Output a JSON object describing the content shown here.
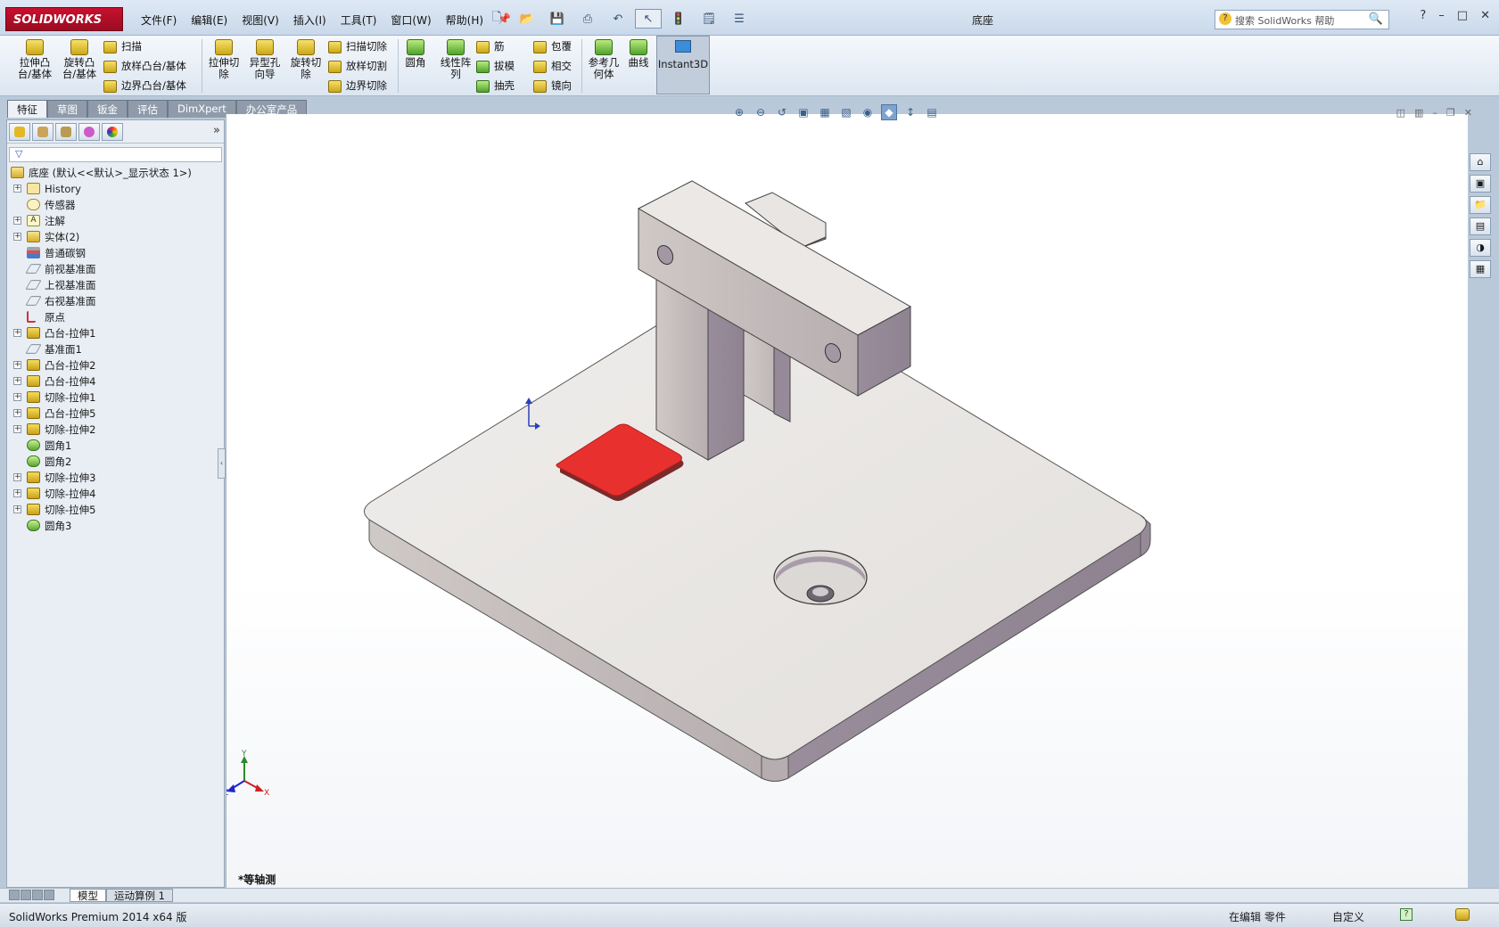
{
  "app": {
    "logo_text": "SOLIDWORKS",
    "document_title": "底座"
  },
  "menu": [
    "文件(F)",
    "编辑(E)",
    "视图(V)",
    "插入(I)",
    "工具(T)",
    "窗口(W)",
    "帮助(H)"
  ],
  "help_search": {
    "placeholder": "搜索 SolidWorks 帮助"
  },
  "ribbon": {
    "extrude_boss": "拉伸凸\n台/基体",
    "revolve_boss": "旋转凸\n台/基体",
    "sweep": "扫描",
    "loft_boss": "放样凸台/基体",
    "boundary_boss": "边界凸台/基体",
    "extrude_cut": "拉伸切\n除",
    "hole_wizard": "异型孔\n向导",
    "revolve_cut": "旋转切\n除",
    "sweep_cut": "扫描切除",
    "loft_cut": "放样切割",
    "boundary_cut": "边界切除",
    "fillet": "圆角",
    "linear_pattern": "线性阵\n列",
    "rib": "筋",
    "draft": "拔模",
    "shell": "抽壳",
    "wrap": "包覆",
    "intersect": "相交",
    "mirror": "镜向",
    "ref_geometry": "参考几\n何体",
    "curves": "曲线",
    "instant3d": "Instant3D"
  },
  "tabs": [
    "特征",
    "草图",
    "钣金",
    "评估",
    "DimXpert",
    "办公室产品"
  ],
  "tree": {
    "root": "底座 (默认<<默认>_显示状态 1>)",
    "items": [
      {
        "label": "History",
        "icon": "history",
        "expandable": true
      },
      {
        "label": "传感器",
        "icon": "sensor",
        "expandable": false
      },
      {
        "label": "注解",
        "icon": "note",
        "expandable": true
      },
      {
        "label": "实体(2)",
        "icon": "folder",
        "expandable": true
      },
      {
        "label": "普通碳钢",
        "icon": "material",
        "expandable": false
      },
      {
        "label": "前视基准面",
        "icon": "plane",
        "expandable": false
      },
      {
        "label": "上视基准面",
        "icon": "plane",
        "expandable": false
      },
      {
        "label": "右视基准面",
        "icon": "plane",
        "expandable": false
      },
      {
        "label": "原点",
        "icon": "origin",
        "expandable": false
      },
      {
        "label": "凸台-拉伸1",
        "icon": "feature",
        "expandable": true
      },
      {
        "label": "基准面1",
        "icon": "plane",
        "expandable": false
      },
      {
        "label": "凸台-拉伸2",
        "icon": "feature",
        "expandable": true
      },
      {
        "label": "凸台-拉伸4",
        "icon": "feature",
        "expandable": true
      },
      {
        "label": "切除-拉伸1",
        "icon": "feature",
        "expandable": true
      },
      {
        "label": "凸台-拉伸5",
        "icon": "feature",
        "expandable": true
      },
      {
        "label": "切除-拉伸2",
        "icon": "feature",
        "expandable": true
      },
      {
        "label": "圆角1",
        "icon": "fillet",
        "expandable": false
      },
      {
        "label": "圆角2",
        "icon": "fillet",
        "expandable": false
      },
      {
        "label": "切除-拉伸3",
        "icon": "feature",
        "expandable": true
      },
      {
        "label": "切除-拉伸4",
        "icon": "feature",
        "expandable": true
      },
      {
        "label": "切除-拉伸5",
        "icon": "feature",
        "expandable": true
      },
      {
        "label": "圆角3",
        "icon": "fillet",
        "expandable": false
      }
    ]
  },
  "viewport": {
    "view_name": "*等轴测",
    "triad": {
      "x": "X",
      "y": "Y",
      "z": "Z"
    },
    "model_colors": {
      "face_top": "#e9e6e3",
      "face_side": "#a79aa6",
      "highlight": "#e8312f"
    }
  },
  "bottom_tabs": [
    "模型",
    "运动算例 1"
  ],
  "status": {
    "app": "SolidWorks Premium 2014 x64 版",
    "editing": "在编辑 零件",
    "units": "自定义"
  }
}
